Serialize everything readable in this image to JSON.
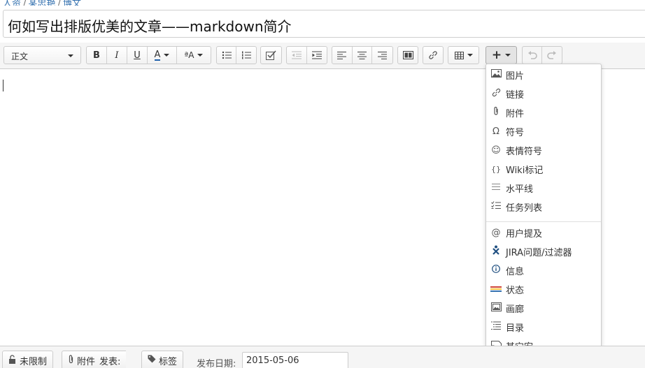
{
  "breadcrumb": {
    "items": [
      "人资",
      "某忠艳",
      "博文"
    ]
  },
  "title": {
    "value": "何如写出排版优美的文章——markdown简介"
  },
  "toolbar": {
    "format_select": "正文",
    "bold": "B",
    "italic": "I",
    "underline": "U",
    "text_color": "A",
    "text_style": "ªA",
    "insert": "+"
  },
  "insert_menu": {
    "items": [
      {
        "label": "图片",
        "icon": "image-icon"
      },
      {
        "label": "链接",
        "icon": "link-icon"
      },
      {
        "label": "附件",
        "icon": "paperclip-icon"
      },
      {
        "label": "符号",
        "icon": "omega-icon"
      },
      {
        "label": "表情符号",
        "icon": "smiley-icon"
      },
      {
        "label": "Wiki标记",
        "icon": "braces-icon"
      },
      {
        "label": "水平线",
        "icon": "horizontal-rule-icon"
      },
      {
        "label": "任务列表",
        "icon": "task-list-icon"
      },
      {
        "label": "用户提及",
        "icon": "at-icon"
      },
      {
        "label": "JIRA问题/过滤器",
        "icon": "jira-icon"
      },
      {
        "label": "信息",
        "icon": "info-icon"
      },
      {
        "label": "状态",
        "icon": "status-icon"
      },
      {
        "label": "画廊",
        "icon": "gallery-icon"
      },
      {
        "label": "目录",
        "icon": "toc-icon"
      },
      {
        "label": "其它宏",
        "icon": "macro-icon"
      }
    ]
  },
  "footer": {
    "restrictions": "未限制",
    "attachments": "附件",
    "publish": "发表:",
    "labels": "标签",
    "publish_date_label": "发布日期:",
    "publish_date": "2015-05-06"
  },
  "colors": {
    "accent": "#3572b0",
    "jira": "#205081",
    "text_color_underline": "#1f5faa"
  }
}
